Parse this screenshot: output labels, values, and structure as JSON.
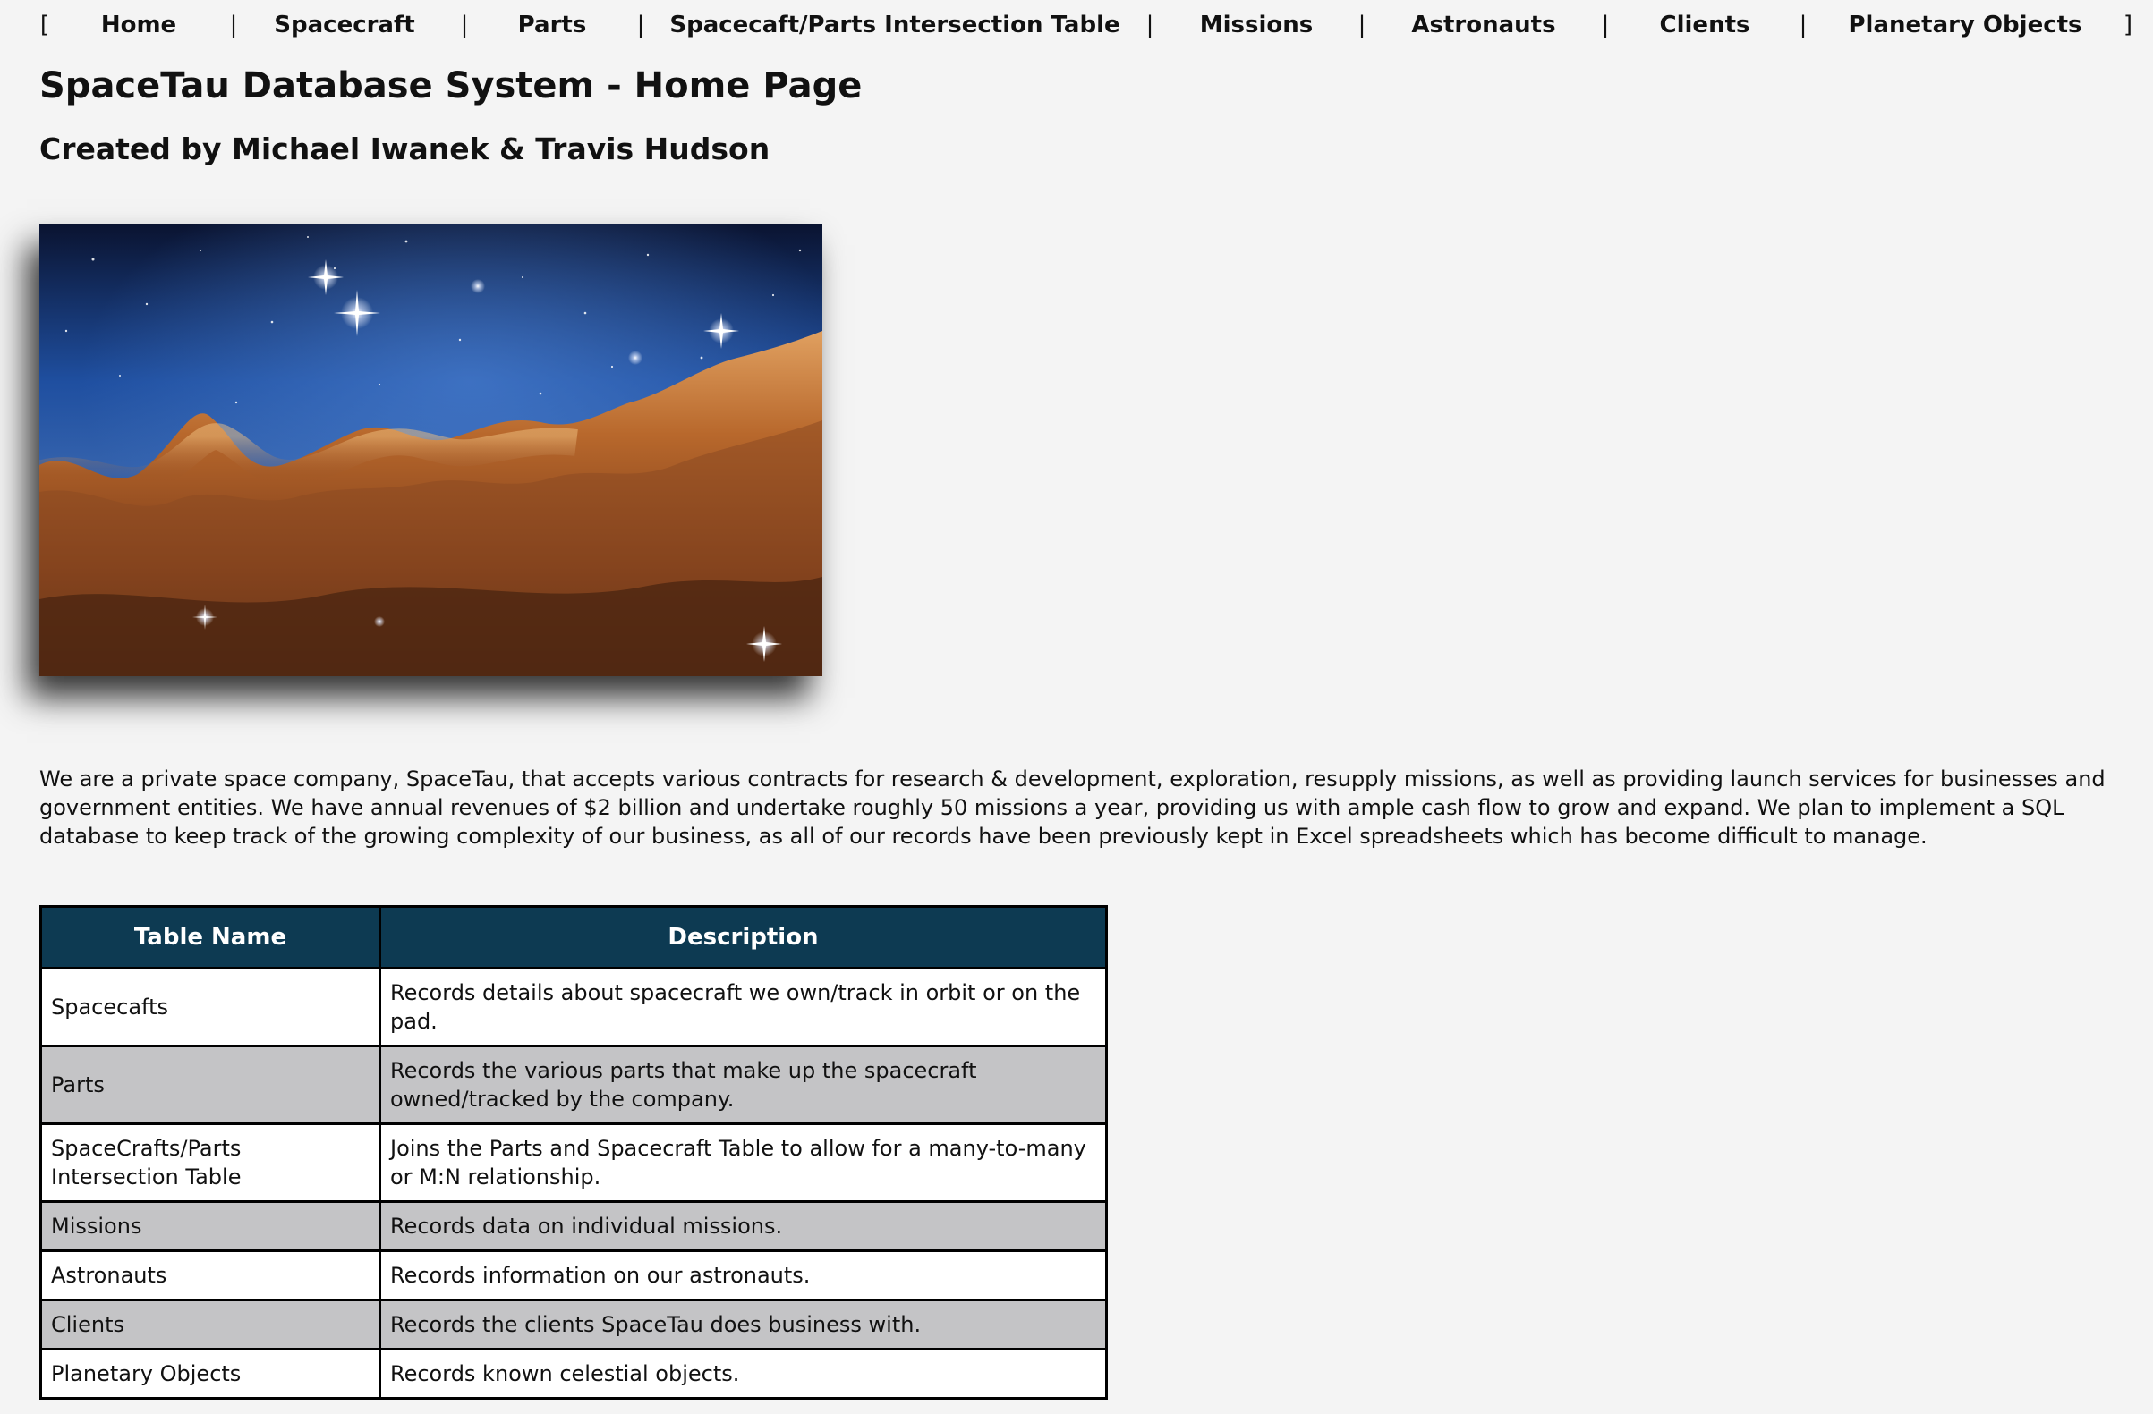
{
  "nav": {
    "open_bracket": "[",
    "close_bracket": "]",
    "separator": "|",
    "links": [
      "Home",
      "Spacecraft",
      "Parts",
      "Spacecaft/Parts Intersection Table",
      "Missions",
      "Astronauts",
      "Clients",
      "Planetary Objects"
    ]
  },
  "page": {
    "title": "SpaceTau Database System - Home Page",
    "subtitle": "Created by Michael Iwanek & Travis Hudson"
  },
  "hero": {
    "image": "nebula-photo"
  },
  "intro": {
    "text": "We are a private space company, SpaceTau, that accepts various contracts for research & development, exploration, resupply missions, as well as providing launch services for businesses and government entities. We have annual revenues of $2 billion and undertake roughly 50 missions a year, providing us with ample cash flow to grow and expand. We plan to implement a SQL database to keep track of the growing complexity of our business, as all of our records have been previously kept in Excel spreadsheets which has become difficult to manage."
  },
  "table": {
    "headers": [
      "Table Name",
      "Description"
    ],
    "rows": [
      {
        "name": "Spacecafts",
        "description": "Records details about spacecraft we own/track in orbit or on the pad."
      },
      {
        "name": "Parts",
        "description": "Records the various parts that make up the spacecraft owned/tracked by the company."
      },
      {
        "name": "SpaceCrafts/Parts Intersection Table",
        "description": "Joins the Parts and Spacecraft Table to allow for a many-to-many or M:N relationship."
      },
      {
        "name": "Missions",
        "description": "Records data on individual missions."
      },
      {
        "name": "Astronauts",
        "description": "Records information on our astronauts."
      },
      {
        "name": "Clients",
        "description": "Records the clients SpaceTau does business with."
      },
      {
        "name": "Planetary Objects",
        "description": "Records known celestial objects."
      }
    ]
  },
  "colors": {
    "background": "#f4f4f4",
    "table_header": "#0d3a52",
    "row_alt": "#c4c4c6"
  }
}
